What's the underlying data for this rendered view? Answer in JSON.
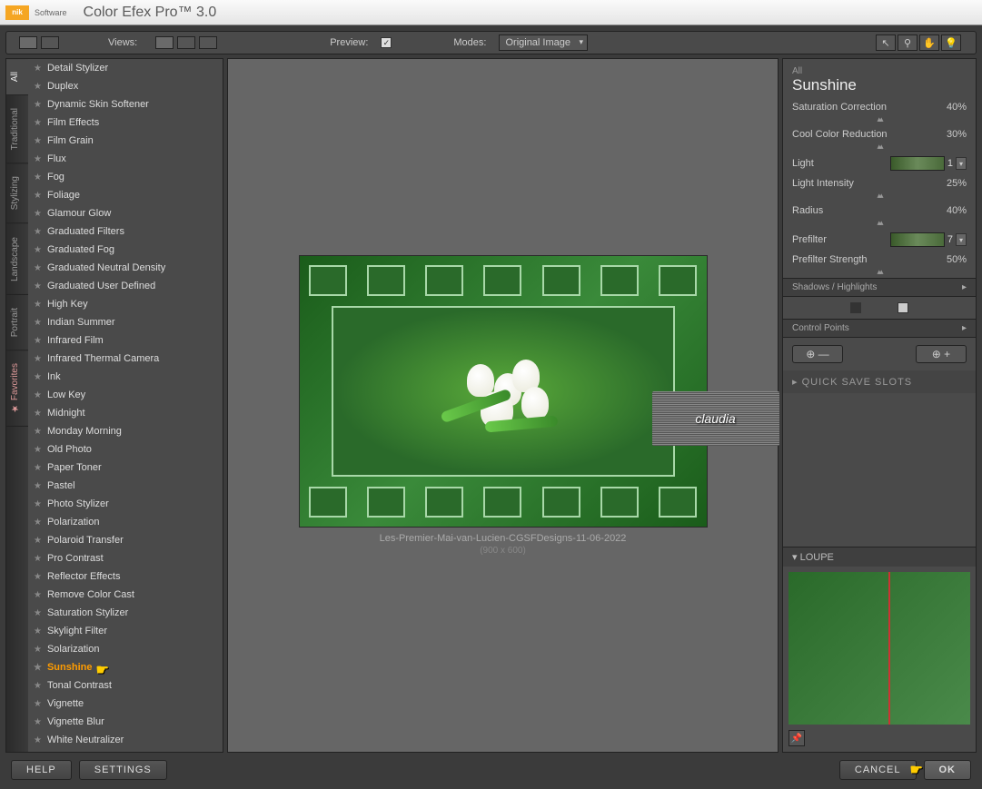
{
  "titlebar": {
    "nik": "nik",
    "brand": "Software",
    "app": "Color Efex Pro™ 3.0"
  },
  "toolbar": {
    "views": "Views:",
    "preview": "Preview:",
    "modes": "Modes:",
    "mode_selected": "Original Image"
  },
  "vtabs": [
    "All",
    "Traditional",
    "Stylizing",
    "Landscape",
    "Portrait",
    "Favorites"
  ],
  "filters": [
    "Detail Stylizer",
    "Duplex",
    "Dynamic Skin Softener",
    "Film Effects",
    "Film Grain",
    "Flux",
    "Fog",
    "Foliage",
    "Glamour Glow",
    "Graduated Filters",
    "Graduated Fog",
    "Graduated Neutral Density",
    "Graduated User Defined",
    "High Key",
    "Indian Summer",
    "Infrared Film",
    "Infrared Thermal Camera",
    "Ink",
    "Low Key",
    "Midnight",
    "Monday Morning",
    "Old Photo",
    "Paper Toner",
    "Pastel",
    "Photo Stylizer",
    "Polarization",
    "Polaroid Transfer",
    "Pro Contrast",
    "Reflector Effects",
    "Remove Color Cast",
    "Saturation Stylizer",
    "Skylight Filter",
    "Solarization",
    "Sunshine",
    "Tonal Contrast",
    "Vignette",
    "Vignette Blur",
    "White Neutralizer"
  ],
  "selected_filter": "Sunshine",
  "image": {
    "caption": "Les-Premier-Mai-van-Lucien-CGSFDesigns-11-06-2022",
    "dims": "(900 x 600)",
    "logo": "claudia"
  },
  "controls": {
    "header_small": "All",
    "header": "Sunshine",
    "sat_corr": {
      "label": "Saturation Correction",
      "value": "40%"
    },
    "cool_red": {
      "label": "Cool Color Reduction",
      "value": "30%"
    },
    "light": {
      "label": "Light",
      "preset": "1"
    },
    "light_int": {
      "label": "Light Intensity",
      "value": "25%"
    },
    "radius": {
      "label": "Radius",
      "value": "40%"
    },
    "prefilter": {
      "label": "Prefilter",
      "preset": "7"
    },
    "prefilter_str": {
      "label": "Prefilter Strength",
      "value": "50%"
    },
    "shadows": "Shadows / Highlights",
    "control_points": "Control Points",
    "quick_save": "QUICK SAVE SLOTS",
    "loupe": "LOUPE"
  },
  "bottom": {
    "help": "HELP",
    "settings": "SETTINGS",
    "cancel": "CANCEL",
    "ok": "OK"
  }
}
